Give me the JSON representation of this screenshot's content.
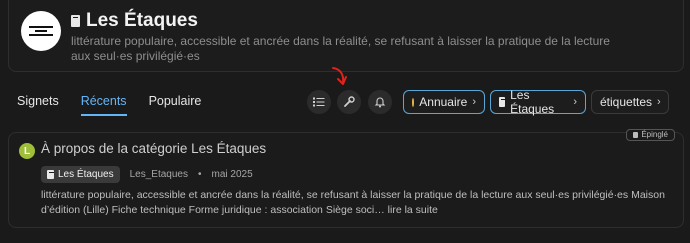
{
  "category": {
    "name": "Les Étaques",
    "description": "littérature populaire, accessible et ancrée dans la réalité, se refusant à laisser la pratique de la lecture aux seul·es privilégié·es"
  },
  "nav": {
    "tabs": [
      {
        "label": "Signets"
      },
      {
        "label": "Récents"
      },
      {
        "label": "Populaire"
      }
    ]
  },
  "filters": {
    "annuaire": "Annuaire",
    "category": "Les Étaques",
    "tags": "étiquettes"
  },
  "topic": {
    "title": "À propos de la catégorie Les Étaques",
    "avatar_letter": "L",
    "category_badge": "Les Étaques",
    "author": "Les_Etaques",
    "date": "mai 2025",
    "pinned_label": "Épinglé",
    "excerpt": "littérature populaire, accessible et ancrée dans la réalité, se refusant à laisser la pratique de la lecture aux seul·es privilégié·es Maison d’édition (Lille) Fiche technique Forme juridique : association Siège soci… lire la suite"
  },
  "colors": {
    "accent": "#64b5f6",
    "annotation_arrow": "#e0231c",
    "avatar_bg": "#9fbf3a"
  }
}
